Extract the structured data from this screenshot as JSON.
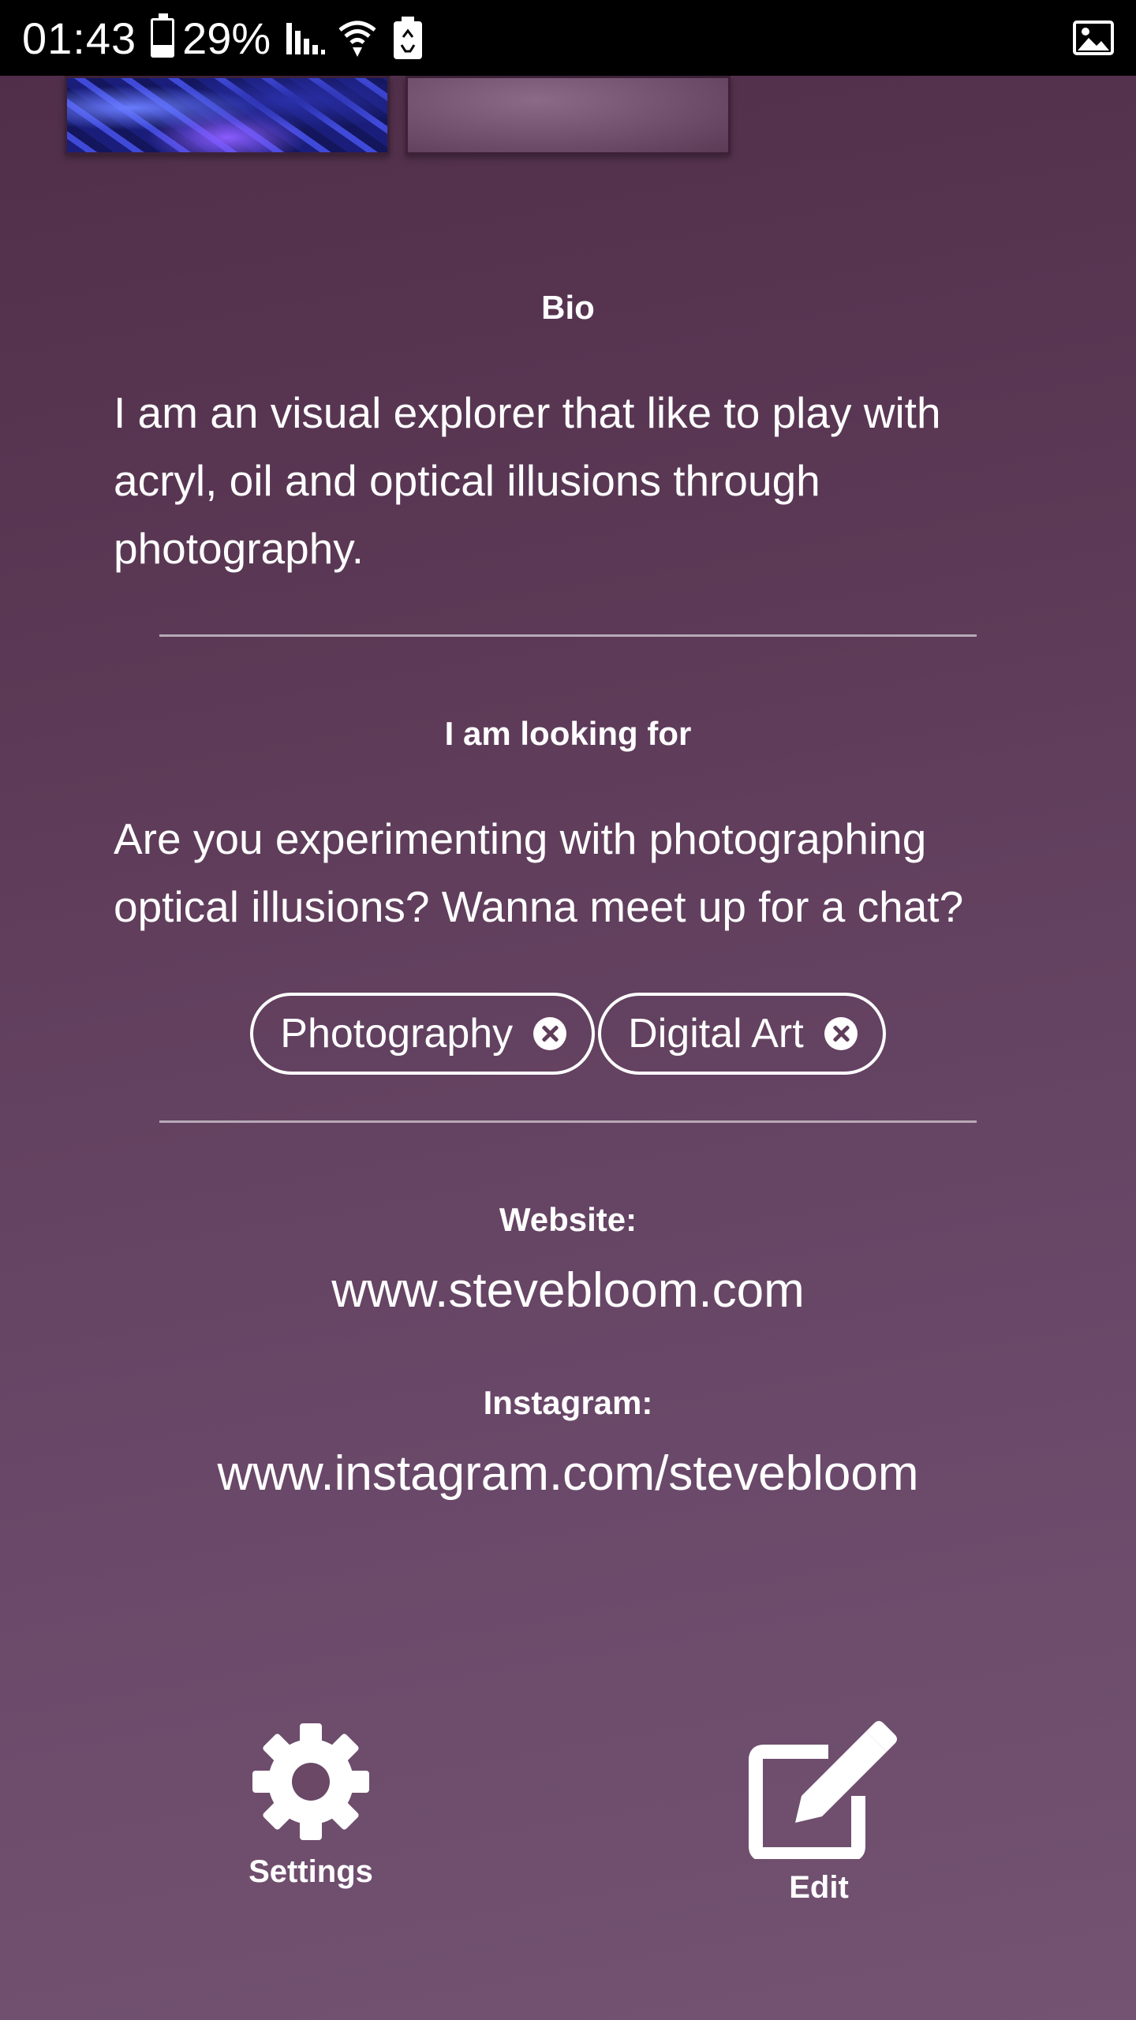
{
  "status_bar": {
    "time": "01:43",
    "battery": "29%",
    "icons": [
      "battery-icon",
      "signal-icon",
      "wifi-icon",
      "recycle-icon",
      "image-icon"
    ]
  },
  "gallery": {
    "thumbnails": [
      "painting-thumbnail",
      "purple-thumbnail"
    ]
  },
  "bio": {
    "heading": "Bio",
    "text": "I am an visual explorer that like to play with acryl, oil and optical illusions through photography."
  },
  "looking_for": {
    "heading": "I am looking for",
    "text": "Are you experimenting with photographing optical illusions? Wanna meet up for a chat?",
    "tags": [
      {
        "label": "Photography"
      },
      {
        "label": "Digital Art"
      }
    ]
  },
  "website": {
    "label": "Website:",
    "value": "www.stevebloom.com"
  },
  "instagram": {
    "label": "Instagram:",
    "value": "www.instagram.com/stevebloom"
  },
  "actions": {
    "settings_label": "Settings",
    "edit_label": "Edit"
  },
  "colors": {
    "background_top": "#4f2d48",
    "background_bottom": "#735371",
    "text": "#ffffff",
    "divider": "#b8a9b6"
  }
}
